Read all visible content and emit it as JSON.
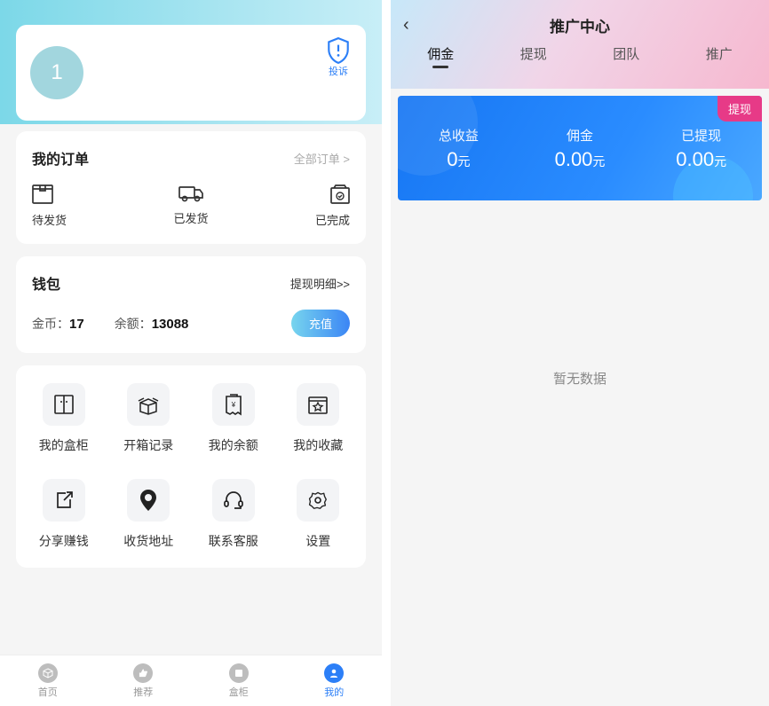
{
  "left": {
    "avatar_text": "1",
    "complaint_label": "投诉",
    "orders": {
      "title": "我的订单",
      "all_link": "全部订单 >",
      "items": [
        "待发货",
        "已发货",
        "已完成"
      ]
    },
    "wallet": {
      "title": "钱包",
      "detail_link": "提现明细>>",
      "coin_label": "金币：",
      "coin_value": "17",
      "balance_label": "余额：",
      "balance_value": "13088",
      "recharge": "充值"
    },
    "grid": {
      "row1": [
        "我的盒柜",
        "开箱记录",
        "我的余额",
        "我的收藏"
      ],
      "row2": [
        "分享赚钱",
        "收货地址",
        "联系客服",
        "设置"
      ]
    },
    "tabbar": [
      "首页",
      "推荐",
      "盒柜",
      "我的"
    ]
  },
  "right": {
    "title": "推广中心",
    "tabs": [
      "佣金",
      "提现",
      "团队",
      "推广"
    ],
    "banner": {
      "withdraw_btn": "提现",
      "stats": [
        {
          "label": "总收益",
          "value": "0",
          "unit": "元"
        },
        {
          "label": "佣金",
          "value": "0.00",
          "unit": "元"
        },
        {
          "label": "已提现",
          "value": "0.00",
          "unit": "元"
        }
      ]
    },
    "empty": "暂无数据"
  }
}
